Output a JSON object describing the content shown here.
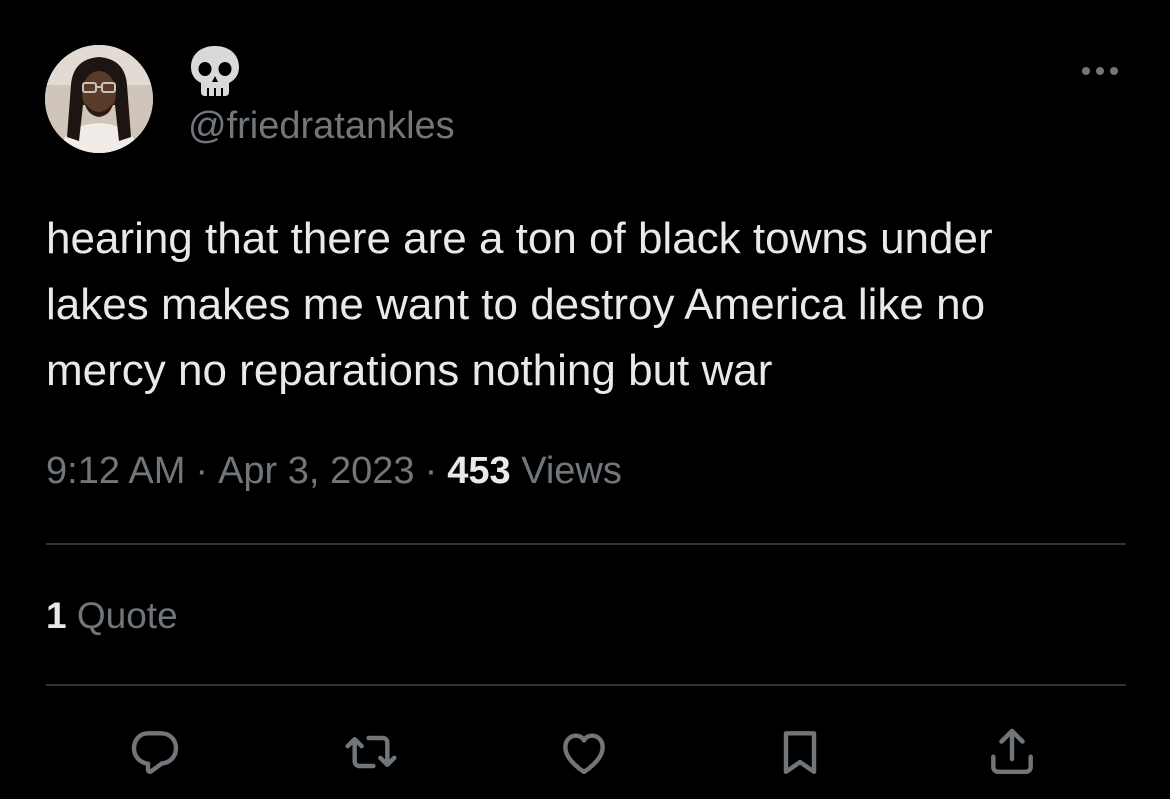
{
  "author": {
    "display_name_icon": "skull-emoji",
    "handle": "@friedratankles"
  },
  "tweet": {
    "text_lines": [
      "hearing that there are a ton of black towns under",
      "lakes makes me want to destroy America like no",
      "mercy no reparations nothing but war"
    ],
    "time": "9:12 AM",
    "date": "Apr 3, 2023",
    "separator": "·",
    "views_count": "453",
    "views_label": "Views"
  },
  "engagement": {
    "quote_count": "1",
    "quote_label": "Quote"
  },
  "actions": [
    "reply-icon",
    "retweet-icon",
    "like-icon",
    "bookmark-icon",
    "share-icon"
  ],
  "colors": {
    "background": "#000000",
    "primary_text": "#e7e9ea",
    "secondary_text": "#71767b",
    "divider": "#2f3336"
  }
}
